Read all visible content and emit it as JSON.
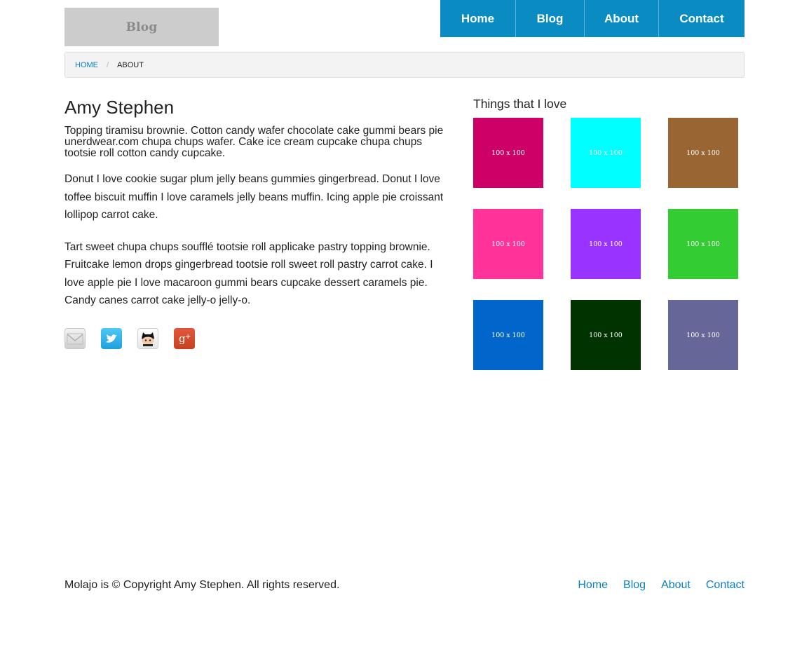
{
  "header": {
    "logo_text": "Blog",
    "nav": [
      "Home",
      "Blog",
      "About",
      "Contact"
    ]
  },
  "breadcrumb": {
    "home": "HOME",
    "divider": "/",
    "current": "ABOUT"
  },
  "main": {
    "title": "Amy Stephen",
    "lead": "Topping tiramisu brownie. Cotton candy wafer chocolate cake gummi bears pie unerdwear.com chupa chups wafer. Cake ice cream cupcake chupa chups tootsie roll cotton candy cupcake.",
    "paragraphs": [
      "Donut I love cookie sugar plum jelly beans gummies gingerbread. Donut I love toffee biscuit muffin I love caramels jelly beans muffin. Icing apple pie croissant lollipop carrot cake.",
      "Tart sweet chupa chups soufflé tootsie roll applicake pastry topping brownie. Fruitcake lemon drops gingerbread tootsie roll sweet roll pastry carrot cake. I love apple pie I love macaroon gummi bears cupcake dessert caramels pie. Candy canes carrot cake jelly-o jelly-o."
    ],
    "social_icons": [
      "mail-icon",
      "twitter-icon",
      "github-icon",
      "google-plus-icon"
    ]
  },
  "sidebar": {
    "title": "Things that I love",
    "tiles": [
      {
        "label": "100 x 100",
        "bg": "#cc0066",
        "fg": "#ffffff"
      },
      {
        "label": "100 x 100",
        "bg": "#00ffff",
        "fg": "#ffffff"
      },
      {
        "label": "100 x 100",
        "bg": "#996633",
        "fg": "#ffffff"
      },
      {
        "label": "100 x 100",
        "bg": "#ff3399",
        "fg": "#ffffff"
      },
      {
        "label": "100 x 100",
        "bg": "#9933ff",
        "fg": "#ffffff"
      },
      {
        "label": "100 x 100",
        "bg": "#33cc33",
        "fg": "#ffffff"
      },
      {
        "label": "100 x 100",
        "bg": "#0066cc",
        "fg": "#ffffff"
      },
      {
        "label": "100 x 100",
        "bg": "#003300",
        "fg": "#ffffff"
      },
      {
        "label": "100 x 100",
        "bg": "#666699",
        "fg": "#ffffff"
      }
    ]
  },
  "footer": {
    "copyright": "Molajo is © Copyright Amy Stephen. All rights reserved.",
    "links": [
      "Home",
      "Blog",
      "About",
      "Contact"
    ]
  },
  "colors": {
    "accent": "#0a8bc1",
    "link": "#0a7fc1",
    "logo_bg": "#cccccc",
    "breadcrumb_bg": "#f3f3f3"
  }
}
